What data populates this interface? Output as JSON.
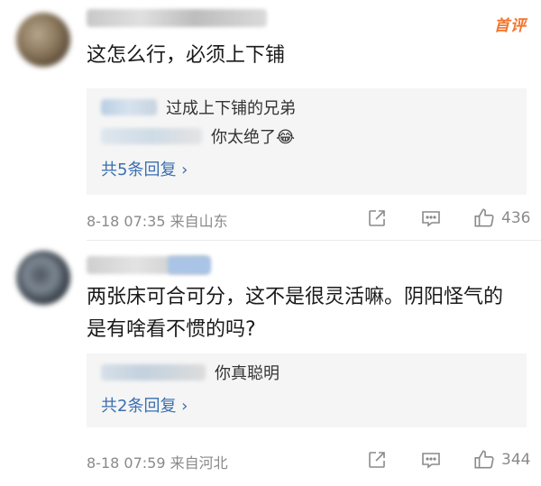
{
  "comments": [
    {
      "badge": "首评",
      "text": "这怎么行，必须上下铺",
      "replies": [
        {
          "text": "过成上下铺的兄弟"
        },
        {
          "text": "你太绝了😂"
        }
      ],
      "more_replies": "共5条回复 ›",
      "meta": "8-18 07:35 来自山东",
      "likes": "436"
    },
    {
      "text": "两张床可合可分，这不是很灵活嘛。阴阳怪气的是有啥看不惯的吗?",
      "replies": [
        {
          "text": "你真聪明"
        }
      ],
      "more_replies": "共2条回复 ›",
      "meta": "8-18 07:59 来自河北",
      "likes": "344"
    }
  ],
  "icons": {
    "share": "share-icon",
    "comment": "comment-icon",
    "like": "thumbs-up-icon"
  },
  "colors": {
    "link": "#3a6fb0",
    "badge": "#f3742b",
    "meta": "#8a8a8a",
    "reply_bg": "#f5f5f5"
  }
}
